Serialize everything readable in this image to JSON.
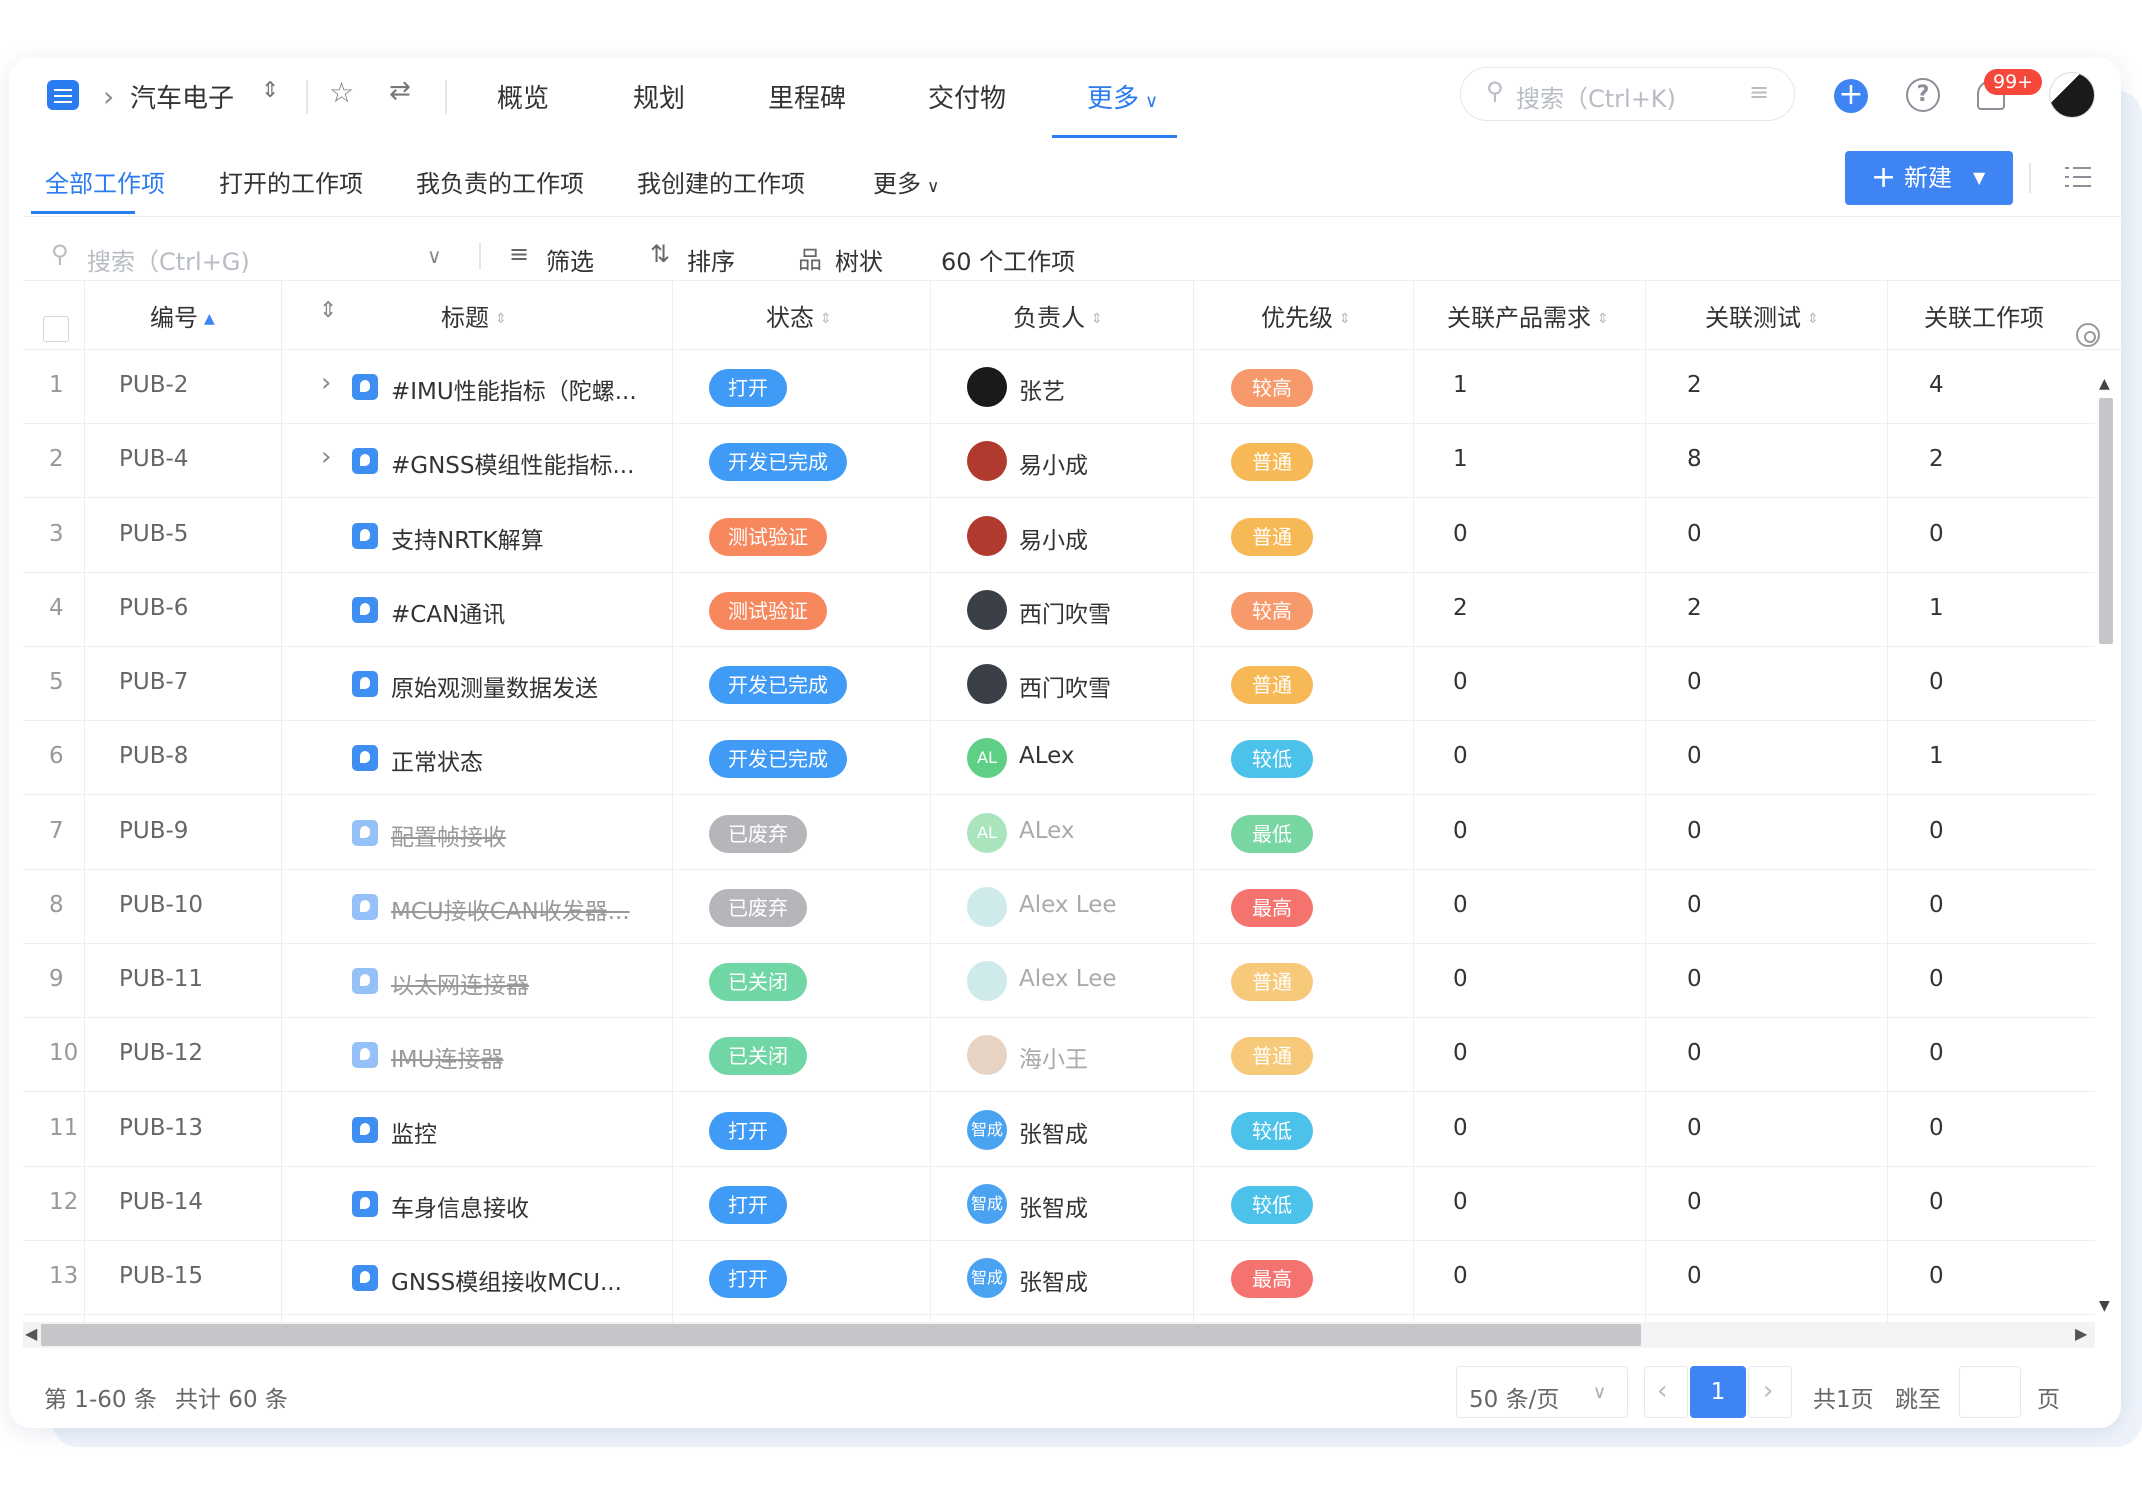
{
  "nav": {
    "project": "汽车电子",
    "tabs": [
      "概览",
      "规划",
      "里程碑",
      "交付物",
      "更多"
    ],
    "search_placeholder": "搜索（Ctrl+K)",
    "notif_count": "99+"
  },
  "subtabs": [
    "全部工作项",
    "打开的工作项",
    "我负责的工作项",
    "我创建的工作项",
    "更多"
  ],
  "new_button": "新建",
  "filterbar": {
    "search_placeholder": "搜索（Ctrl+G)",
    "filter": "筛选",
    "sort": "排序",
    "tree": "树状",
    "count": "60 个工作项"
  },
  "columns": {
    "id": "编号",
    "title": "标题",
    "status": "状态",
    "owner": "负责人",
    "priority": "优先级",
    "rel_req": "关联产品需求",
    "rel_test": "关联测试",
    "rel_item": "关联工作项"
  },
  "colors": {
    "accent": "#3f84f3",
    "status_open": "#3f9bf5",
    "status_test": "#f7885e",
    "status_done": "#3f9bf5",
    "status_abandoned": "#b4b6ba",
    "status_closed": "#6fd6a4",
    "prio_high": "#f79a6b",
    "prio_normal": "#f7b955",
    "prio_low": "#4cc2ea",
    "prio_lowest": "#78d6a2",
    "prio_highest": "#f4736e"
  },
  "rows": [
    {
      "no": "1",
      "id": "PUB-2",
      "expand": true,
      "title": "#IMU性能指标（陀螺...",
      "status": "打开",
      "status_color": "#3f9bf5",
      "owner": "张艺",
      "avatar": "#1a1a1a",
      "avatar_text": "",
      "prio": "较高",
      "prio_color": "#f79a6b",
      "req": "1",
      "test": "2",
      "item": "4",
      "faded": false
    },
    {
      "no": "2",
      "id": "PUB-4",
      "expand": true,
      "title": "#GNSS模组性能指标...",
      "status": "开发已完成",
      "status_color": "#3f9bf5",
      "owner": "易小成",
      "avatar": "#b03a2e",
      "avatar_text": "",
      "prio": "普通",
      "prio_color": "#f7b955",
      "req": "1",
      "test": "8",
      "item": "2",
      "faded": false
    },
    {
      "no": "3",
      "id": "PUB-5",
      "expand": false,
      "title": "支持NRTK解算",
      "status": "测试验证",
      "status_color": "#f7885e",
      "owner": "易小成",
      "avatar": "#b03a2e",
      "avatar_text": "",
      "prio": "普通",
      "prio_color": "#f7b955",
      "req": "0",
      "test": "0",
      "item": "0",
      "faded": false
    },
    {
      "no": "4",
      "id": "PUB-6",
      "expand": false,
      "title": "#CAN通讯",
      "status": "测试验证",
      "status_color": "#f7885e",
      "owner": "西门吹雪",
      "avatar": "#3b3f47",
      "avatar_text": "",
      "prio": "较高",
      "prio_color": "#f79a6b",
      "req": "2",
      "test": "2",
      "item": "1",
      "faded": false
    },
    {
      "no": "5",
      "id": "PUB-7",
      "expand": false,
      "title": "原始观测量数据发送",
      "status": "开发已完成",
      "status_color": "#3f9bf5",
      "owner": "西门吹雪",
      "avatar": "#3b3f47",
      "avatar_text": "",
      "prio": "普通",
      "prio_color": "#f7b955",
      "req": "0",
      "test": "0",
      "item": "0",
      "faded": false
    },
    {
      "no": "6",
      "id": "PUB-8",
      "expand": false,
      "title": "正常状态",
      "status": "开发已完成",
      "status_color": "#3f9bf5",
      "owner": "ALex",
      "avatar": "#5fcf86",
      "avatar_text": "AL",
      "prio": "较低",
      "prio_color": "#4cc2ea",
      "req": "0",
      "test": "0",
      "item": "1",
      "faded": false
    },
    {
      "no": "7",
      "id": "PUB-9",
      "expand": false,
      "title": "配置帧接收",
      "status": "已废弃",
      "status_color": "#b4b6ba",
      "owner": "ALex",
      "avatar": "#a9e4bd",
      "avatar_text": "AL",
      "prio": "最低",
      "prio_color": "#78d6a2",
      "req": "0",
      "test": "0",
      "item": "0",
      "faded": true
    },
    {
      "no": "8",
      "id": "PUB-10",
      "expand": false,
      "title": "MCU接收CAN收发器...",
      "status": "已废弃",
      "status_color": "#b4b6ba",
      "owner": "Alex Lee",
      "avatar": "#cfeaea",
      "avatar_text": "",
      "prio": "最高",
      "prio_color": "#f4736e",
      "req": "0",
      "test": "0",
      "item": "0",
      "faded": true
    },
    {
      "no": "9",
      "id": "PUB-11",
      "expand": false,
      "title": "以太网连接器",
      "status": "已关闭",
      "status_color": "#6fd6a4",
      "owner": "Alex Lee",
      "avatar": "#cfeaea",
      "avatar_text": "",
      "prio": "普通",
      "prio_color": "#f7c97a",
      "req": "0",
      "test": "0",
      "item": "0",
      "faded": true
    },
    {
      "no": "10",
      "id": "PUB-12",
      "expand": false,
      "title": "IMU连接器",
      "status": "已关闭",
      "status_color": "#6fd6a4",
      "owner": "海小王",
      "avatar": "#e6d3c3",
      "avatar_text": "",
      "prio": "普通",
      "prio_color": "#f7c97a",
      "req": "0",
      "test": "0",
      "item": "0",
      "faded": true
    },
    {
      "no": "11",
      "id": "PUB-13",
      "expand": false,
      "title": "监控",
      "status": "打开",
      "status_color": "#3f9bf5",
      "owner": "张智成",
      "avatar": "#4aa3f0",
      "avatar_text": "智成",
      "prio": "较低",
      "prio_color": "#4cc2ea",
      "req": "0",
      "test": "0",
      "item": "0",
      "faded": false
    },
    {
      "no": "12",
      "id": "PUB-14",
      "expand": false,
      "title": "车身信息接收",
      "status": "打开",
      "status_color": "#3f9bf5",
      "owner": "张智成",
      "avatar": "#4aa3f0",
      "avatar_text": "智成",
      "prio": "较低",
      "prio_color": "#4cc2ea",
      "req": "0",
      "test": "0",
      "item": "0",
      "faded": false
    },
    {
      "no": "13",
      "id": "PUB-15",
      "expand": false,
      "title": "GNSS模组接收MCU...",
      "status": "打开",
      "status_color": "#3f9bf5",
      "owner": "张智成",
      "avatar": "#4aa3f0",
      "avatar_text": "智成",
      "prio": "最高",
      "prio_color": "#f4736e",
      "req": "0",
      "test": "0",
      "item": "0",
      "faded": false
    }
  ],
  "footer": {
    "range": "第 1-60 条",
    "total": "共计 60 条",
    "page_size": "50 条/页",
    "current_page": "1",
    "total_pages": "共1页",
    "jump_label": "跳至",
    "page_unit": "页"
  }
}
